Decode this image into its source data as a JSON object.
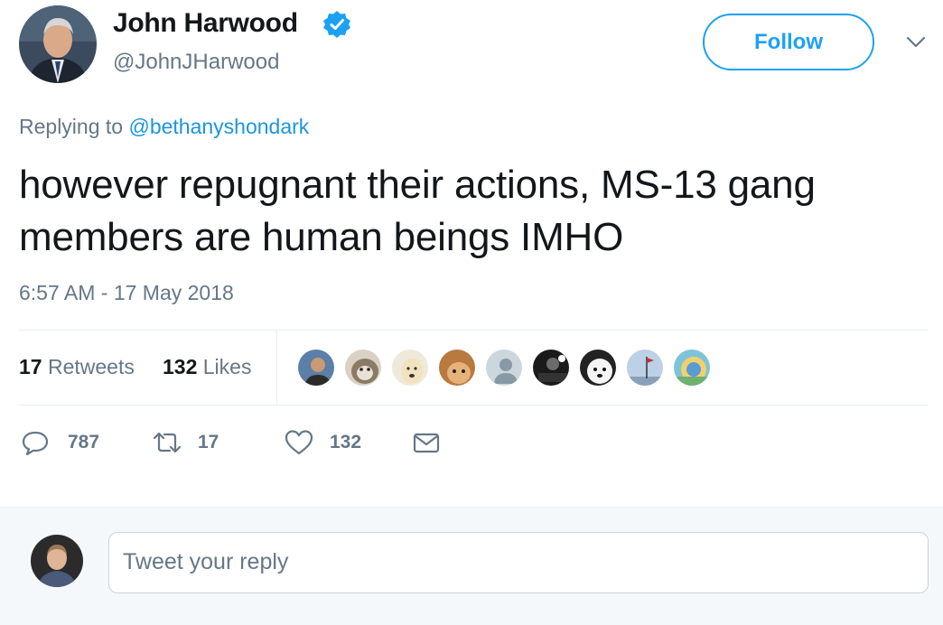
{
  "tweet": {
    "display_name": "John Harwood",
    "handle": "@JohnJHarwood",
    "follow_label": "Follow",
    "replying_prefix": "Replying to",
    "replying_to": "@bethanyshondark",
    "text": "however repugnant their actions, MS-13 gang members are human beings IMHO",
    "timestamp": "6:57 AM - 17 May 2018"
  },
  "stats": {
    "retweets_count": "17",
    "retweets_label": "Retweets",
    "likes_count": "132",
    "likes_label": "Likes"
  },
  "actions": {
    "reply_count": "787",
    "retweet_count": "17",
    "like_count": "132"
  },
  "reply": {
    "placeholder": "Tweet your reply"
  },
  "colors": {
    "accent": "#1da1f2",
    "link": "#1b95e0",
    "muted": "#657786",
    "text": "#14171a"
  }
}
